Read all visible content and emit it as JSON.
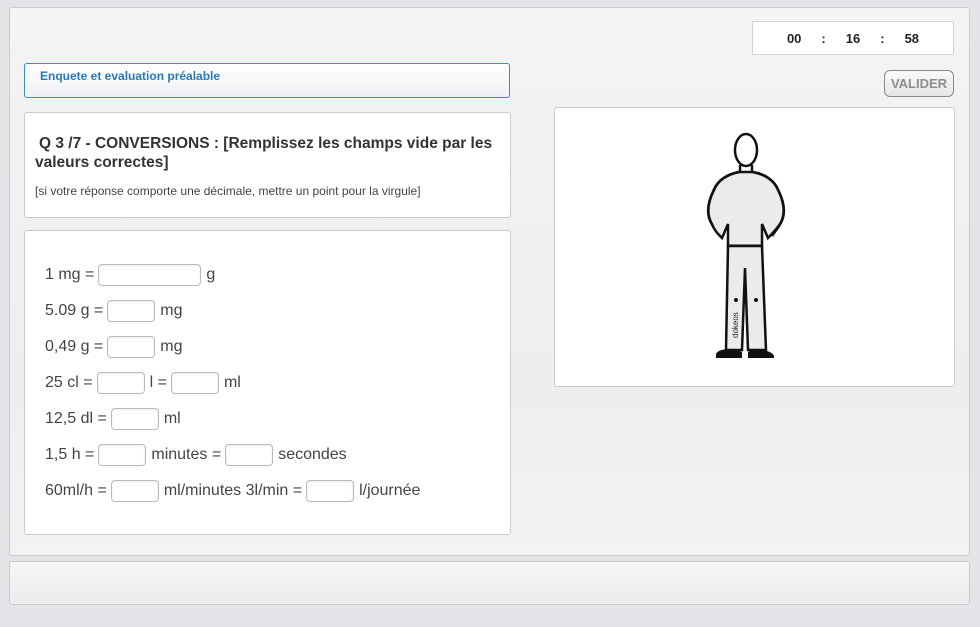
{
  "timer": {
    "hours": "00",
    "minutes": "16",
    "seconds": "58",
    "separator": ":"
  },
  "toolbar": {
    "validate_label": "VALIDER"
  },
  "subject": {
    "label": "Enquete et evaluation préalable"
  },
  "question": {
    "title": "Q 3 /7 - CONVERSIONS : [Remplissez les champs vide par les valeurs correctes]",
    "note": "[si votre réponse comporte une décimale, mettre un point pour la virgule]"
  },
  "rows": [
    {
      "before": "1 mg =",
      "after": "g"
    },
    {
      "before": "5.09 g =",
      "after": "mg"
    },
    {
      "before": "0,49 g =",
      "after": "mg"
    },
    {
      "before": "25 cl =",
      "middle": "l =",
      "after": "ml"
    },
    {
      "before": "12,5 dl =",
      "after": "ml"
    },
    {
      "before": "1,5 h =",
      "middle": "minutes =",
      "after": "secondes"
    },
    {
      "before": "60ml/h =",
      "middle": "ml/minutes 3l/min =",
      "after": "l/journée"
    }
  ],
  "figure": {
    "brand": "dokeos"
  },
  "colors": {
    "accent": "#2a7ab5",
    "panel_border": "#c9cbce"
  }
}
